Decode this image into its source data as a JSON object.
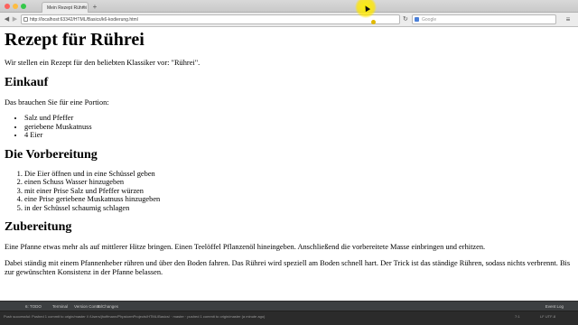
{
  "browser": {
    "tab_title": "Mein Rezept Rührei",
    "tab_close_glyph": "×",
    "new_tab_glyph": "+",
    "url": "http://localhost:63342/HTML/Basics/k6-kodierung.html",
    "search_placeholder": "Google",
    "icons": [
      "back-icon",
      "forward-icon",
      "reload-icon",
      "search-engine-icon",
      "menu-icon"
    ]
  },
  "page": {
    "title": "Rezept für Rührei",
    "intro": "Wir stellen ein Rezept für den beliebten Klassiker vor: \"Rührei\".",
    "einkauf": {
      "heading": "Einkauf",
      "text": "Das brauchen Sie für eine Portion:",
      "items": [
        "Salz und Pfeffer",
        "geriebene Muskatnuss",
        "4 Eier"
      ]
    },
    "vorbereitung": {
      "heading": "Die Vorbereitung",
      "steps": [
        "Die Eier öffnen und in eine Schüssel geben",
        "einen Schuss Wasser hinzugeben",
        "mit einer Prise Salz und Pfeffer würzen",
        "eine Prise geriebene Muskatnuss hinzugeben",
        "in der Schüssel schaumig schlagen"
      ]
    },
    "zubereitung": {
      "heading": "Zubereitung",
      "p1": "Eine Pfanne etwas mehr als auf mittlerer Hitze bringen. Einen Teelöffel Pflanzenöl hineingeben. Anschließend die vorbereitete Masse einbringen und erhitzen.",
      "p2": "Dabei ständig mit einem Pfannenheber rühren und über den Boden fahren. Das Rührei wird speziell am Boden schnell hart. Der Trick ist das ständige Rühren, sodass nichts verbrennt. Bis zur gewünschten Konsistenz in der Pfanne belassen."
    }
  },
  "ide": {
    "tabs": [
      "6: TODO",
      "Terminal",
      "Version Control",
      "9: Changes"
    ],
    "event_log": "Event Log",
    "status_message": "Push successful: Pushed 1 commit to origin/master  //  /Users/jhoffmann/PhpstormProjects/HTML/Basics/ · master · pushed 1 commit to origin/master (a minute ago)",
    "position": "7:1",
    "encoding": "LF  UTF-8"
  },
  "colors": {
    "cursor_highlight": "#ffea00",
    "ide_bg": "#3c3f41",
    "status_bg": "#2b2b2b"
  }
}
